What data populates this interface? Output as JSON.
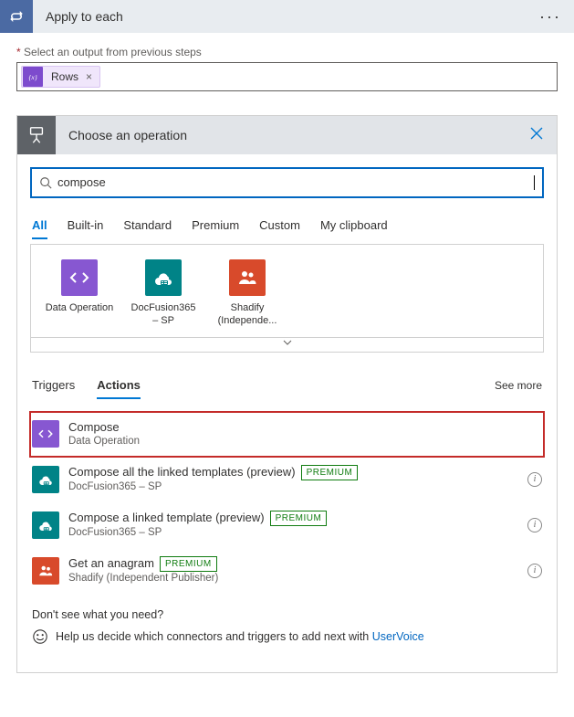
{
  "header": {
    "title": "Apply to each"
  },
  "output": {
    "label": "Select an output from previous steps",
    "token_label": "Rows"
  },
  "operation": {
    "title": "Choose an operation",
    "search_value": "compose",
    "cat_tabs": [
      "All",
      "Built-in",
      "Standard",
      "Premium",
      "Custom",
      "My clipboard"
    ],
    "active_cat": 0,
    "connectors": [
      {
        "name": "Data Operation",
        "color": "conn-purple",
        "icon": "code"
      },
      {
        "name": "DocFusion365 – SP",
        "color": "conn-teal",
        "icon": "cloud"
      },
      {
        "name": "Shadify (Independe...",
        "color": "conn-red",
        "icon": "people"
      }
    ],
    "sub_tabs": [
      "Triggers",
      "Actions"
    ],
    "active_sub": 1,
    "see_more": "See more",
    "actions": [
      {
        "title": "Compose",
        "sub": "Data Operation",
        "color": "conn-purple",
        "icon": "code",
        "premium": false,
        "highlight": true
      },
      {
        "title": "Compose all the linked templates (preview)",
        "sub": "DocFusion365 – SP",
        "color": "conn-teal",
        "icon": "cloud",
        "premium": true,
        "highlight": false
      },
      {
        "title": "Compose a linked template (preview)",
        "sub": "DocFusion365 – SP",
        "color": "conn-teal",
        "icon": "cloud",
        "premium": true,
        "highlight": false
      },
      {
        "title": "Get an anagram",
        "sub": "Shadify (Independent Publisher)",
        "color": "conn-red",
        "icon": "people",
        "premium": true,
        "highlight": false
      }
    ],
    "premium_label": "PREMIUM",
    "footer_q": "Don't see what you need?",
    "footer_help_prefix": "Help us decide which connectors and triggers to add next with ",
    "footer_link": "UserVoice"
  }
}
